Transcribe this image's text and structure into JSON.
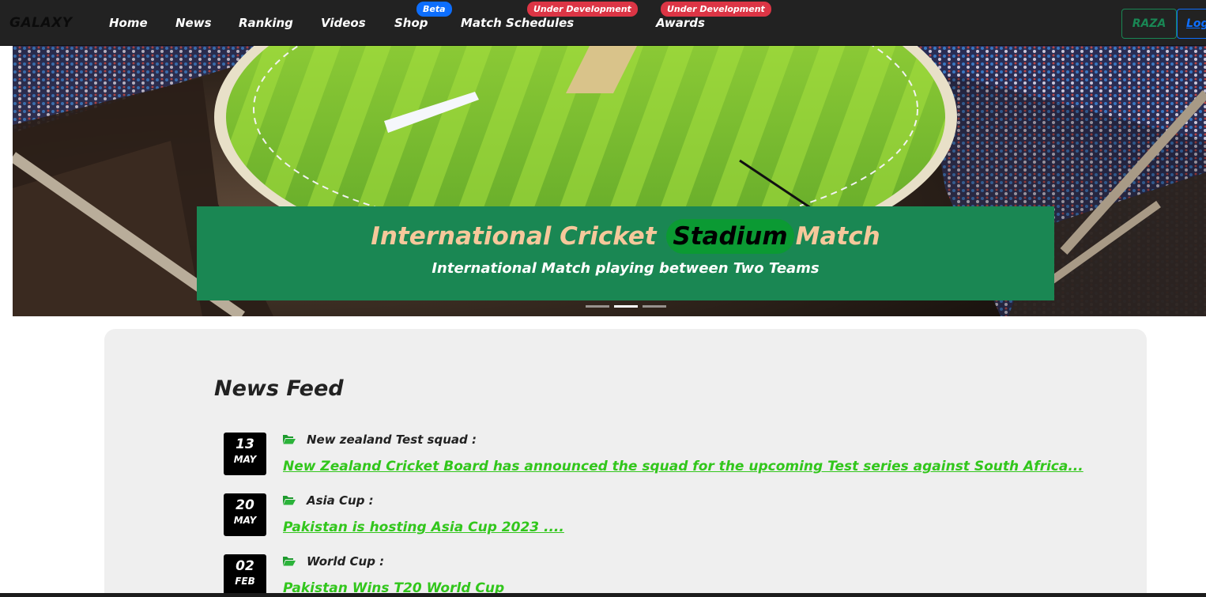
{
  "nav": {
    "brand": "GALAXY",
    "items": [
      {
        "label": "Home"
      },
      {
        "label": "News"
      },
      {
        "label": "Ranking"
      },
      {
        "label": "Videos"
      },
      {
        "label": "Shop",
        "badge": "Beta"
      },
      {
        "label": "Match Schedules",
        "badge": "Under Development"
      },
      {
        "label": "Awards",
        "badge": "Under Development"
      }
    ],
    "user_button": "RAZA",
    "login_button": "Logout"
  },
  "hero": {
    "title_before": "International Cricket",
    "title_highlight": "Stadium",
    "title_after": "Match",
    "subtitle": "International Match playing between Two Teams",
    "slides": 3,
    "active_slide": 2
  },
  "news": {
    "heading": "News Feed",
    "items": [
      {
        "day": "13",
        "month": "MAY",
        "category": "New zealand Test squad :",
        "headline": "New Zealand Cricket Board has announced the squad for the upcoming Test series against South Africa..."
      },
      {
        "day": "20",
        "month": "MAY",
        "category": "Asia Cup :",
        "headline": "Pakistan is hosting Asia Cup 2023 ...."
      },
      {
        "day": "02",
        "month": "FEB",
        "category": "World Cup :",
        "headline": "Pakistan Wins T20 World Cup"
      }
    ]
  },
  "colors": {
    "navbar_bg": "#222222",
    "caption_bg": "#1a8753",
    "caption_title": "#f6c89b",
    "highlight_bg": "#0b9a33",
    "link_green": "#32c61c",
    "badge_blue": "#0d6efd",
    "badge_red": "#dc3545"
  }
}
